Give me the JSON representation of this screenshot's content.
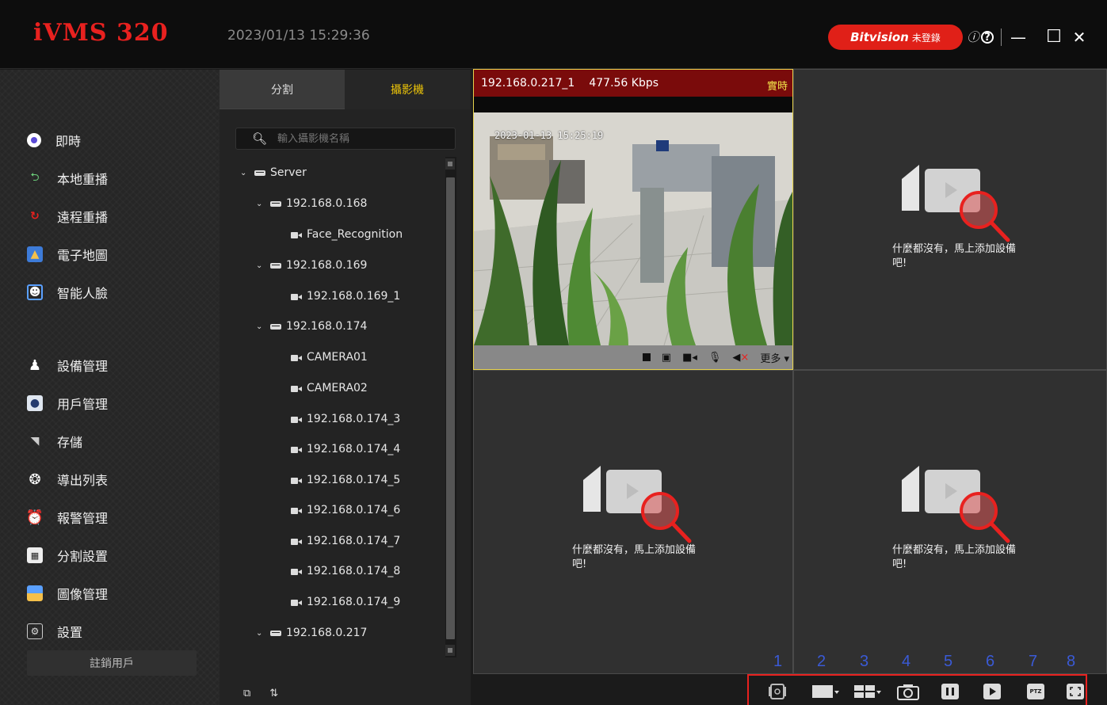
{
  "app": {
    "logo": "iVMS 320",
    "clock": "2023/01/13 15:29:36",
    "brand_name": "Bitvision",
    "brand_status": "未登錄",
    "info_label": "ⓘ",
    "help_label": "?",
    "minimize_label": "—",
    "maximize_label": "☐",
    "close_label": "✕"
  },
  "nav": {
    "items": [
      {
        "label": "即時",
        "icon": "live-view-icon"
      },
      {
        "label": "本地重播",
        "icon": "local-playback-icon"
      },
      {
        "label": "遠程重播",
        "icon": "remote-playback-icon"
      },
      {
        "label": "電子地圖",
        "icon": "e-map-icon"
      },
      {
        "label": "智能人臉",
        "icon": "face-recognition-icon"
      },
      {
        "label": "設備管理",
        "icon": "device-management-icon"
      },
      {
        "label": "用戶管理",
        "icon": "user-management-icon"
      },
      {
        "label": "存儲",
        "icon": "storage-icon"
      },
      {
        "label": "導出列表",
        "icon": "export-list-icon"
      },
      {
        "label": "報警管理",
        "icon": "alarm-icon"
      },
      {
        "label": "分割設置",
        "icon": "split-settings-icon"
      },
      {
        "label": "圖像管理",
        "icon": "image-management-icon"
      },
      {
        "label": "設置",
        "icon": "settings-icon"
      }
    ],
    "logout": "註銷用戶"
  },
  "tree_panel": {
    "tab_split": "分割",
    "tab_camera": "攝影機",
    "search_placeholder": "輸入攝影機名稱",
    "nodes": [
      {
        "label": "Server",
        "type": "server"
      },
      {
        "label": "192.168.0.168",
        "type": "nvr"
      },
      {
        "label": "Face_Recognition",
        "type": "camera"
      },
      {
        "label": "192.168.0.169",
        "type": "nvr"
      },
      {
        "label": "192.168.0.169_1",
        "type": "camera"
      },
      {
        "label": "192.168.0.174",
        "type": "nvr"
      },
      {
        "label": "CAMERA01",
        "type": "camera"
      },
      {
        "label": "CAMERA02",
        "type": "camera"
      },
      {
        "label": "192.168.0.174_3",
        "type": "camera"
      },
      {
        "label": "192.168.0.174_4",
        "type": "camera"
      },
      {
        "label": "192.168.0.174_5",
        "type": "camera"
      },
      {
        "label": "192.168.0.174_6",
        "type": "camera"
      },
      {
        "label": "192.168.0.174_7",
        "type": "camera"
      },
      {
        "label": "192.168.0.174_8",
        "type": "camera"
      },
      {
        "label": "192.168.0.174_9",
        "type": "camera"
      },
      {
        "label": "192.168.0.217",
        "type": "nvr"
      }
    ]
  },
  "video": {
    "channel": "192.168.0.217_1",
    "bitrate": "477.56 Kbps",
    "mode": "實時",
    "osd_timestamp": "2023-01-13 15:25:19",
    "more_label": "更多"
  },
  "empty_cell": {
    "text": "什麼都沒有，馬上添加設備吧!"
  },
  "toolbar": {
    "numbers": [
      "1",
      "2",
      "3",
      "4",
      "5",
      "6",
      "7",
      "8"
    ],
    "ptz_label": "PTZ"
  },
  "colors": {
    "accent_red": "#e8211f",
    "active_tab": "#e8c10a",
    "video_bar": "#7a0b0b",
    "annotation_blue": "#3a5ad6"
  }
}
